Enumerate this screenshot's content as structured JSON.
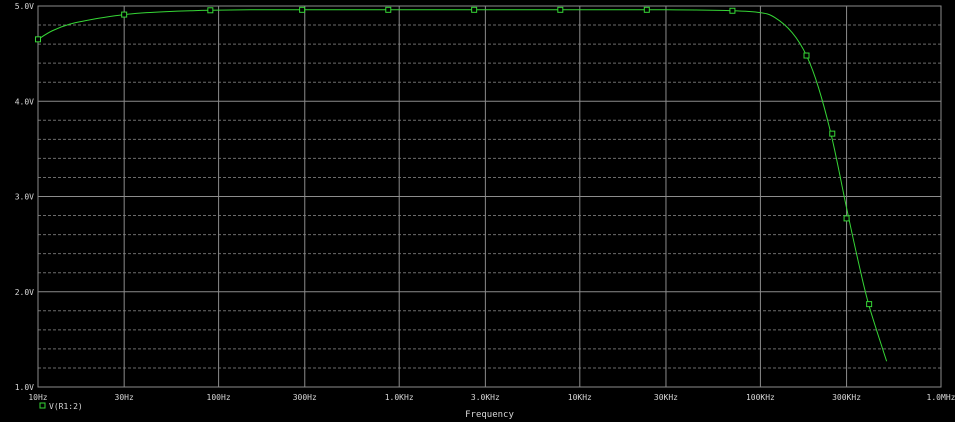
{
  "colors": {
    "background": "#000000",
    "plot_background": "#000000",
    "axis_text": "#d8d8d8",
    "grid_major": "#8c8c8c",
    "grid_minor": "#6c6c6c",
    "trace": "#36d636",
    "marker_edge": "#36d636"
  },
  "chart_data": {
    "type": "line",
    "xlabel": "Frequency",
    "ylabel": "",
    "x_scale": "log",
    "xlim": [
      10,
      1000000
    ],
    "ylim": [
      1.0,
      5.0
    ],
    "grid": "on",
    "legend": "bottom-left",
    "x_tick_values": [
      10,
      30,
      100,
      300,
      1000,
      3000,
      10000,
      30000,
      100000,
      300000,
      1000000
    ],
    "x_tick_labels": [
      "10Hz",
      "30Hz",
      "100Hz",
      "300Hz",
      "1.0KHz",
      "3.0KHz",
      "10KHz",
      "30KHz",
      "100KHz",
      "300KHz",
      "1.0MHz"
    ],
    "y_tick_values": [
      1.0,
      2.0,
      3.0,
      4.0,
      5.0
    ],
    "y_tick_labels": [
      "1.0V",
      "2.0V",
      "3.0V",
      "4.0V",
      "5.0V"
    ],
    "series": [
      {
        "name": "V(R1:2)",
        "x": [
          10,
          12,
          15,
          20,
          25,
          30,
          40,
          50,
          70,
          90,
          150,
          300,
          1000,
          3000,
          10000,
          30000,
          70000,
          100000,
          120000,
          150000,
          180000,
          210000,
          250000,
          300000,
          350000,
          400000,
          500000
        ],
        "y": [
          4.65,
          4.74,
          4.81,
          4.86,
          4.89,
          4.91,
          4.93,
          4.94,
          4.95,
          4.955,
          4.96,
          4.96,
          4.96,
          4.96,
          4.96,
          4.96,
          4.95,
          4.93,
          4.88,
          4.72,
          4.48,
          4.14,
          3.6,
          2.88,
          2.3,
          1.85,
          1.27
        ],
        "marker_x": [
          10,
          30,
          90,
          290,
          870,
          2600,
          7800,
          23500,
          70000,
          180000,
          250000,
          300000,
          400000
        ],
        "marker_y": [
          4.65,
          4.91,
          4.955,
          4.96,
          4.96,
          4.96,
          4.96,
          4.96,
          4.95,
          4.48,
          3.66,
          2.77,
          1.87
        ]
      }
    ]
  }
}
